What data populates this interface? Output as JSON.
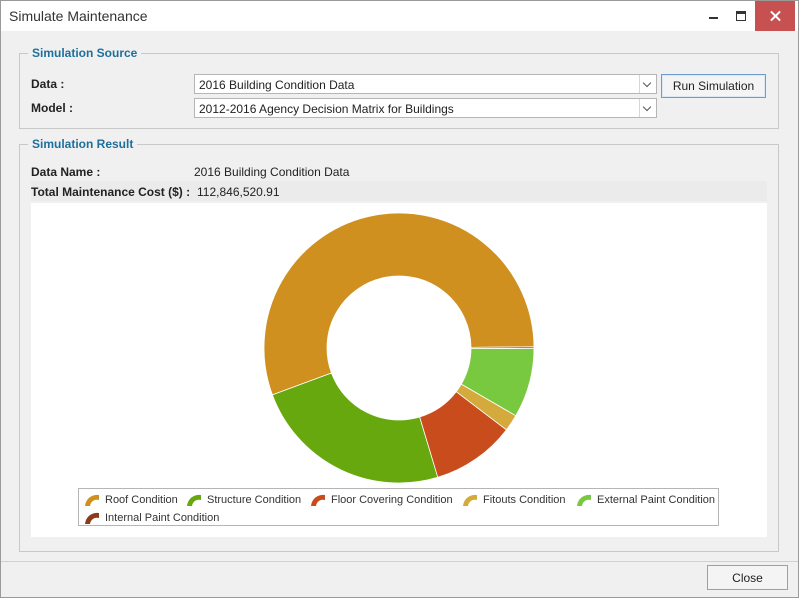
{
  "window": {
    "title": "Simulate Maintenance"
  },
  "source": {
    "title": "Simulation Source",
    "data_label": "Data :",
    "data_value": "2016 Building Condition Data",
    "model_label": "Model :",
    "model_value": "2012-2016 Agency Decision Matrix for Buildings",
    "run_label": "Run Simulation"
  },
  "result": {
    "title": "Simulation Result",
    "data_name_label": "Data Name :",
    "data_name_value": "2016 Building Condition Data",
    "cost_label": "Total Maintenance Cost ($) :",
    "cost_value": "112,846,520.91"
  },
  "chart_data": {
    "type": "pie",
    "donut": true,
    "categories": [
      "Roof Condition",
      "Structure Condition",
      "Floor Covering Condition",
      "Fitouts Condition",
      "External Paint Condition",
      "Internal Paint Condition"
    ],
    "values": [
      55.5,
      24.0,
      10.0,
      2.0,
      8.3,
      0.2
    ],
    "colors": [
      "#D09020",
      "#67A80E",
      "#C84C1C",
      "#D4AA3C",
      "#78C940",
      "#8B3A1A"
    ],
    "legend_position": "bottom"
  },
  "footer": {
    "close_label": "Close"
  }
}
